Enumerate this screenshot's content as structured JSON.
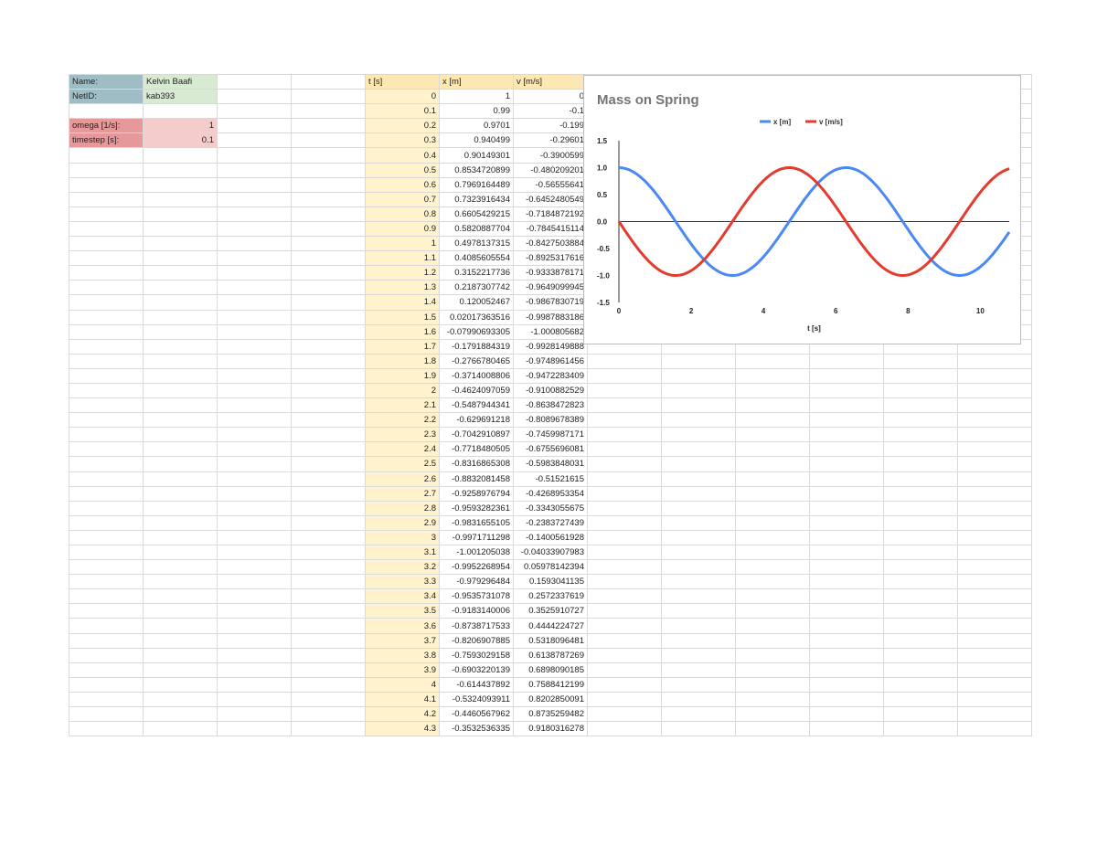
{
  "info": {
    "name_label": "Name:",
    "name_value": "Kelvin Baafi",
    "netid_label": "NetID:",
    "netid_value": "kab393",
    "omega_label": "omega [1/s]:",
    "omega_value": "1",
    "timestep_label": "timestep [s]:",
    "timestep_value": "0.1"
  },
  "table": {
    "headers": [
      "t [s]",
      "x [m]",
      "v [m/s]"
    ],
    "rows": [
      [
        "0",
        "1",
        "0"
      ],
      [
        "0.1",
        "0.99",
        "-0.1"
      ],
      [
        "0.2",
        "0.9701",
        "-0.199"
      ],
      [
        "0.3",
        "0.940499",
        "-0.29601"
      ],
      [
        "0.4",
        "0.90149301",
        "-0.3900599"
      ],
      [
        "0.5",
        "0.8534720899",
        "-0.480209201"
      ],
      [
        "0.6",
        "0.7969164489",
        "-0.56555641"
      ],
      [
        "0.7",
        "0.7323916434",
        "-0.6452480549"
      ],
      [
        "0.8",
        "0.6605429215",
        "-0.7184872192"
      ],
      [
        "0.9",
        "0.5820887704",
        "-0.7845415114"
      ],
      [
        "1",
        "0.4978137315",
        "-0.8427503884"
      ],
      [
        "1.1",
        "0.4085605554",
        "-0.8925317616"
      ],
      [
        "1.2",
        "0.3152217736",
        "-0.9333878171"
      ],
      [
        "1.3",
        "0.2187307742",
        "-0.9649099945"
      ],
      [
        "1.4",
        "0.120052467",
        "-0.9867830719"
      ],
      [
        "1.5",
        "0.02017363516",
        "-0.9987883186"
      ],
      [
        "1.6",
        "-0.07990693305",
        "-1.000805682"
      ],
      [
        "1.7",
        "-0.1791884319",
        "-0.9928149888"
      ],
      [
        "1.8",
        "-0.2766780465",
        "-0.9748961456"
      ],
      [
        "1.9",
        "-0.3714008806",
        "-0.9472283409"
      ],
      [
        "2",
        "-0.4624097059",
        "-0.9100882529"
      ],
      [
        "2.1",
        "-0.5487944341",
        "-0.8638472823"
      ],
      [
        "2.2",
        "-0.629691218",
        "-0.8089678389"
      ],
      [
        "2.3",
        "-0.7042910897",
        "-0.7459987171"
      ],
      [
        "2.4",
        "-0.7718480505",
        "-0.6755696081"
      ],
      [
        "2.5",
        "-0.8316865308",
        "-0.5983848031"
      ],
      [
        "2.6",
        "-0.8832081458",
        "-0.51521615"
      ],
      [
        "2.7",
        "-0.9258976794",
        "-0.4268953354"
      ],
      [
        "2.8",
        "-0.9593282361",
        "-0.3343055675"
      ],
      [
        "2.9",
        "-0.9831655105",
        "-0.2383727439"
      ],
      [
        "3",
        "-0.9971711298",
        "-0.1400561928"
      ],
      [
        "3.1",
        "-1.001205038",
        "-0.04033907983"
      ],
      [
        "3.2",
        "-0.9952268954",
        "0.05978142394"
      ],
      [
        "3.3",
        "-0.979296484",
        "0.1593041135"
      ],
      [
        "3.4",
        "-0.9535731078",
        "0.2572337619"
      ],
      [
        "3.5",
        "-0.9183140006",
        "0.3525910727"
      ],
      [
        "3.6",
        "-0.8738717533",
        "0.4444224727"
      ],
      [
        "3.7",
        "-0.8206907885",
        "0.5318096481"
      ],
      [
        "3.8",
        "-0.7593029158",
        "0.6138787269"
      ],
      [
        "3.9",
        "-0.6903220139",
        "0.6898090185"
      ],
      [
        "4",
        "-0.614437892",
        "0.7588412199"
      ],
      [
        "4.1",
        "-0.5324093911",
        "0.8202850091"
      ],
      [
        "4.2",
        "-0.4460567962",
        "0.8735259482"
      ],
      [
        "4.3",
        "-0.3532536335",
        "0.9180316278"
      ]
    ]
  },
  "chart_data": {
    "type": "line",
    "title": "Mass on Spring",
    "xlabel": "t [s]",
    "ylabel": "",
    "xlim": [
      0,
      10.8
    ],
    "ylim": [
      -1.5,
      1.5
    ],
    "xticks": [
      "0",
      "2",
      "4",
      "6",
      "8",
      "10"
    ],
    "yticks": [
      "1.5",
      "1.0",
      "0.5",
      "0.0",
      "-0.5",
      "-1.0",
      "-1.5"
    ],
    "legend_position": "top",
    "series": [
      {
        "name": "x [m]",
        "color": "#4a89f3",
        "formula": "cos(t)"
      },
      {
        "name": "v [m/s]",
        "color": "#e33b2e",
        "formula": "-sin(t)"
      }
    ]
  }
}
